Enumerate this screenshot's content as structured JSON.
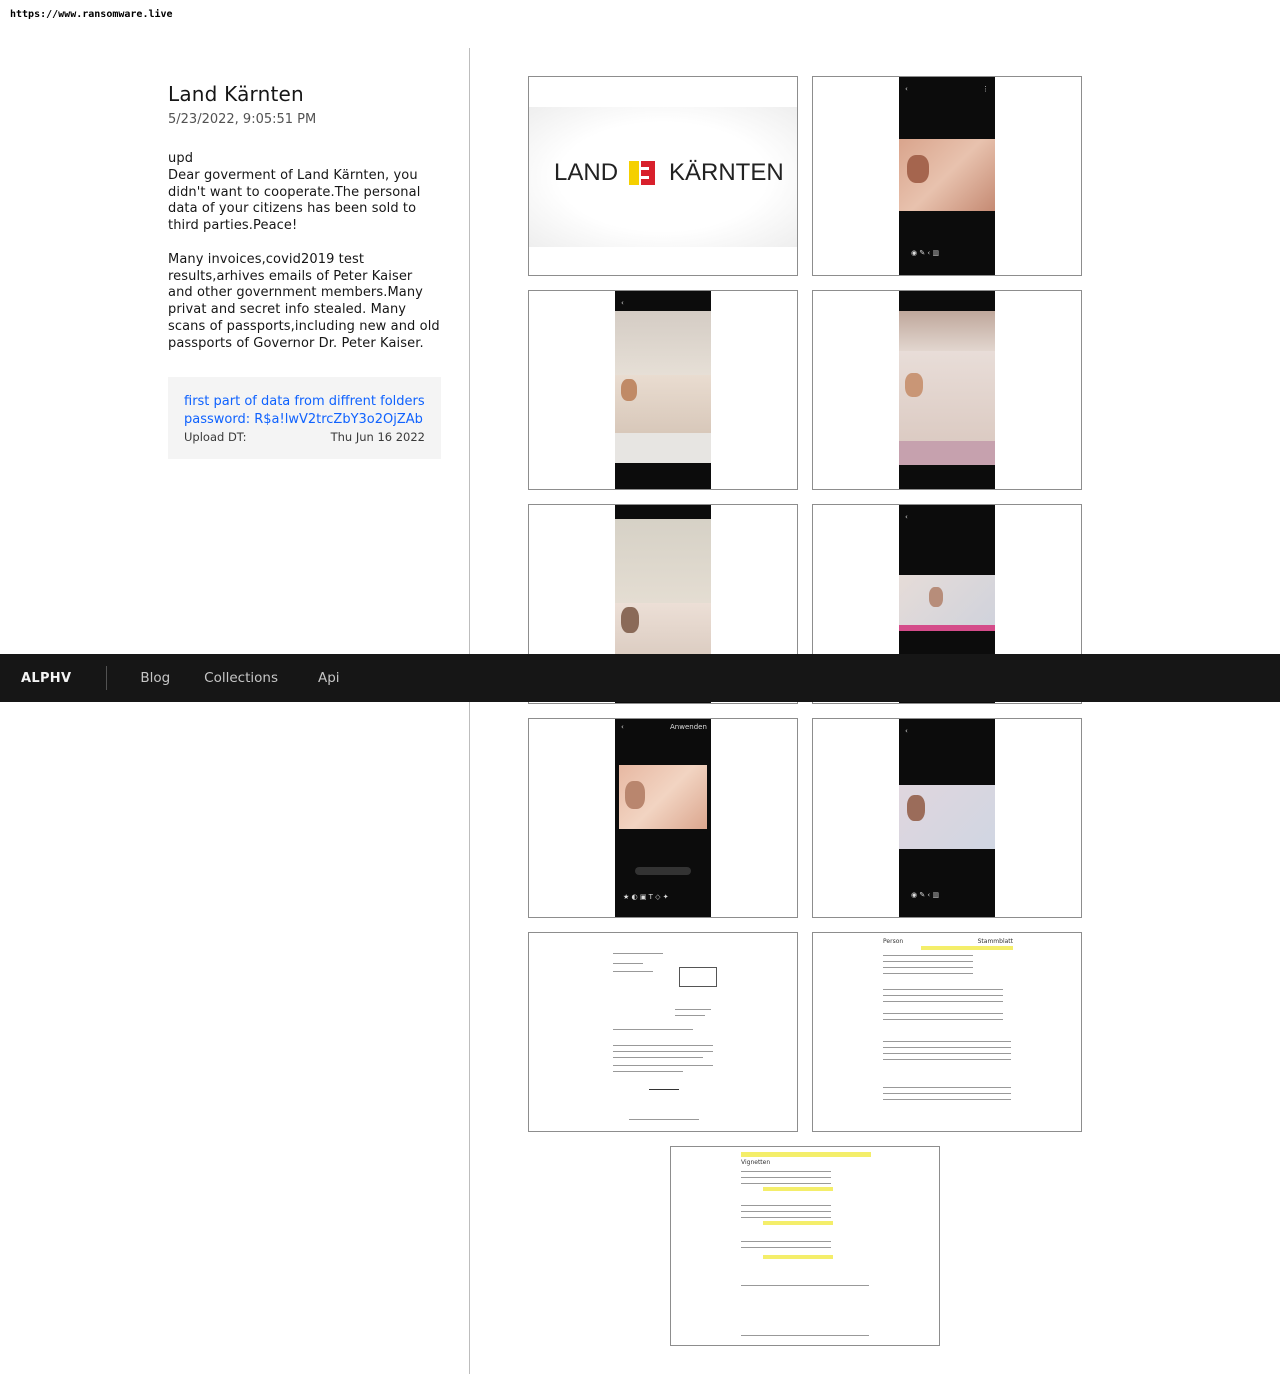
{
  "url_bar": "https://www.ransomware.live",
  "post": {
    "title": "Land Kärnten",
    "date": "5/23/2022, 9:05:51 PM",
    "description": "upd\nDear goverment of Land Kärnten, you didn't want to cooperate.The personal data of your citizens has been sold to third parties.Peace!\n\nMany invoices,covid2019 test results,arhives emails of Peter Kaiser and other government members.Many privat and secret info stealed. Many scans of passports,including new and old passports of Governor Dr. Peter Kaiser.",
    "link_text": "first part of data from diffrent folders",
    "password_text": "password: R$a!lwV2trcZbY3o2OjZAb",
    "upload_label": "Upload DT:",
    "upload_value": "Thu Jun 16 2022"
  },
  "logo": {
    "left": "LAND",
    "right": "KÄRNTEN"
  },
  "phone_ui": {
    "apply_label": "Anwenden"
  },
  "doc_headers": {
    "person": "Person",
    "stammblatt": "Stammblatt",
    "vignetten": "Vignetten"
  },
  "nav": {
    "brand": "ALPHV",
    "links": [
      "Blog",
      "Collections",
      "Api"
    ]
  }
}
